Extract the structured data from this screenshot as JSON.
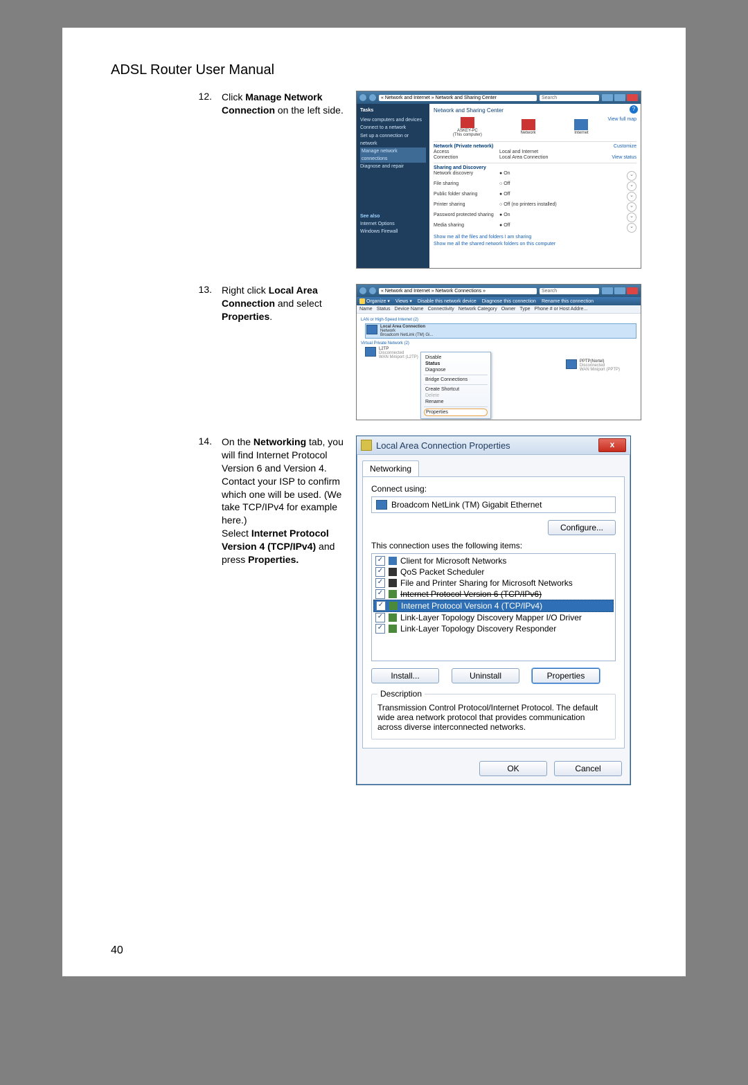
{
  "header": "ADSL Router User Manual",
  "page_number": "40",
  "steps": {
    "s12": {
      "num": "12.",
      "t1": "Click ",
      "b1": "Manage Network Connection",
      "t2": " on the left side."
    },
    "s13": {
      "num": "13.",
      "t1": "Right click ",
      "b1": "Local Area Connection",
      "t2": " and select ",
      "b2": "Properties",
      "t3": "."
    },
    "s14": {
      "num": "14.",
      "t1": "On the ",
      "b1": "Networking",
      "t2": " tab, you will find Internet Protocol Version 6 and Version 4. Contact your ISP to confirm which one will be used. (We take TCP/IPv4 for example here.)",
      "t3": "Select ",
      "b2": "Internet Protocol Version 4 (TCP/IPv4)",
      "t4": " and press ",
      "b3": "Properties."
    }
  },
  "shot1": {
    "breadcrumb": "« Network and Internet » Network and Sharing Center",
    "search": "Search",
    "tasks_hd": "Tasks",
    "tasks": {
      "a": "View computers and devices",
      "b": "Connect to a network",
      "c": "Set up a connection or network",
      "d": "Manage network connections",
      "e": "Diagnose and repair"
    },
    "see_also": "See also",
    "see1": "Internet Options",
    "see2": "Windows Firewall",
    "title": "Network and Sharing Center",
    "view_full_map": "View full map",
    "computer": "ASKEY-PC",
    "computer_sub": "(This computer)",
    "network": "Network",
    "internet": "Internet",
    "net_private": "Network (Private network)",
    "customize": "Customize",
    "access_k": "Access",
    "access_v": "Local and Internet",
    "conn_k": "Connection",
    "conn_v": "Local Area Connection",
    "view_status": "View status",
    "sd_hd": "Sharing and Discovery",
    "nd_k": "Network discovery",
    "nd_v": "On",
    "fs_k": "File sharing",
    "fs_v": "Off",
    "pf_k": "Public folder sharing",
    "pf_v": "Off",
    "ps_k": "Printer sharing",
    "ps_v": "Off (no printers installed)",
    "pp_k": "Password protected sharing",
    "pp_v": "On",
    "ms_k": "Media sharing",
    "ms_v": "Off",
    "foot1": "Show me all the files and folders I am sharing",
    "foot2": "Show me all the shared network folders on this computer"
  },
  "shot2": {
    "breadcrumb": "« Network and Internet » Network Connections »",
    "search": "Search",
    "tb": {
      "org": "Organize ▾",
      "views": "Views ▾",
      "dis": "Disable this network device",
      "diag": "Diagnose this connection",
      "ren": "Rename this connection"
    },
    "cols": {
      "name": "Name",
      "status": "Status",
      "dev": "Device Name",
      "conn": "Connectivity",
      "cat": "Network Category",
      "owner": "Owner",
      "type": "Type",
      "phone": "Phone # or Host Addre..."
    },
    "grp1": "LAN or High-Speed Internet (2)",
    "lac": {
      "name": "Local Area Connection",
      "sub1": "Network",
      "sub2": "Broadcom NetLink (TM) Gi..."
    },
    "grp2": "Virtual Private Network (2)",
    "l2tp": {
      "name": "L2TP",
      "sub1": "Disconnected",
      "sub2": "WAN Miniport (L2TP)"
    },
    "pptp": {
      "name": "PPTP(Nortel)",
      "sub1": "Disconnected",
      "sub2": "WAN Miniport (PPTP)"
    },
    "ctx": {
      "disable": "Disable",
      "status": "Status",
      "diagnose": "Diagnose",
      "bridge": "Bridge Connections",
      "shortcut": "Create Shortcut",
      "delete": "Delete",
      "rename": "Rename",
      "properties": "Properties"
    }
  },
  "shot3": {
    "title": "Local Area Connection Properties",
    "tab": "Networking",
    "connect_using": "Connect using:",
    "adapter": "Broadcom NetLink (TM) Gigabit Ethernet",
    "configure": "Configure...",
    "uses": "This connection uses the following items:",
    "items": {
      "client": "Client for Microsoft Networks",
      "qos": "QoS Packet Scheduler",
      "file": "File and Printer Sharing for Microsoft Networks",
      "ipv6": "Internet Protocol Version 6 (TCP/IPv6)",
      "ipv4": "Internet Protocol Version 4 (TCP/IPv4)",
      "lltd_map": "Link-Layer Topology Discovery Mapper I/O Driver",
      "lltd_resp": "Link-Layer Topology Discovery Responder"
    },
    "install": "Install...",
    "uninstall": "Uninstall",
    "properties": "Properties",
    "desc_legend": "Description",
    "desc": "Transmission Control Protocol/Internet Protocol. The default wide area network protocol that provides communication across diverse interconnected networks.",
    "ok": "OK",
    "cancel": "Cancel"
  }
}
